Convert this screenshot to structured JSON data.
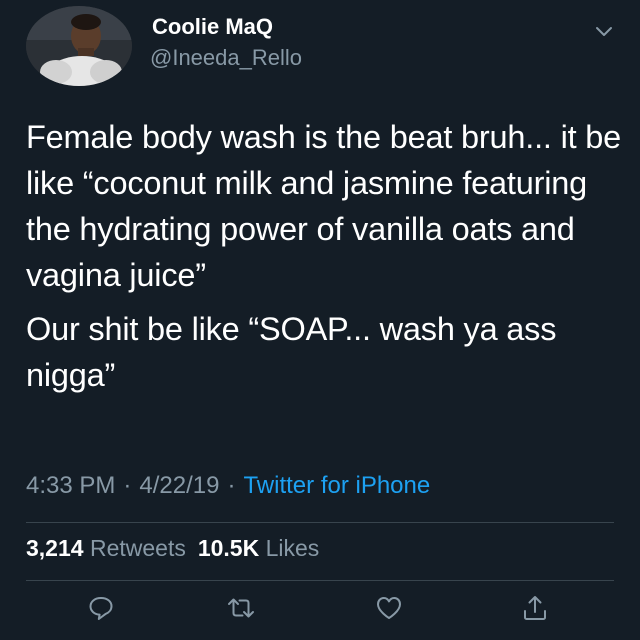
{
  "user": {
    "name": "Coolie MaQ",
    "handle": "@Ineeda_Rello"
  },
  "tweet": {
    "paragraphs": [
      "Female body wash is the beat bruh... it be like “coconut milk and jasmine featuring the hydrating power of vanilla oats and vagina juice”",
      "Our shit be like “SOAP... wash ya ass nigga”"
    ]
  },
  "meta": {
    "time": "4:33 PM",
    "separator": "·",
    "date": "4/22/19",
    "source": "Twitter for iPhone"
  },
  "stats": {
    "retweets_count": "3,214",
    "retweets_label": "Retweets",
    "likes_count": "10.5K",
    "likes_label": "Likes"
  },
  "actions": {
    "reply_icon": "reply-icon",
    "retweet_icon": "retweet-icon",
    "like_icon": "heart-icon",
    "share_icon": "share-icon"
  },
  "colors": {
    "background": "#141d26",
    "text": "#ffffff",
    "secondary": "#8899a6",
    "link": "#1da1f2",
    "divider": "#38444d"
  }
}
